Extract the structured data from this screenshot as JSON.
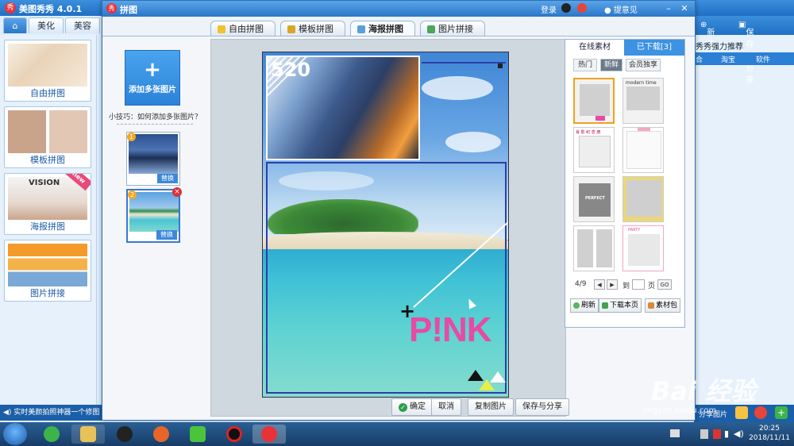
{
  "back_app": {
    "title": "美图秀秀 4.0.1",
    "tabs": [
      "美化",
      "美容"
    ],
    "sidebar": [
      {
        "label": "自由拼图"
      },
      {
        "label": "模板拼图"
      },
      {
        "label": "海报拼图",
        "badge": "new",
        "poster_text": "VISION"
      },
      {
        "label": "图片拼接"
      }
    ],
    "status_text": "实时美颜拍照神器一个修图",
    "right_toolbar": {
      "new_label": "新建",
      "save_label": "保存与分享"
    },
    "recommend_title": "秀秀强力推荐",
    "right_tabs": [
      "合",
      "淘宝",
      "软件"
    ],
    "share_label": "分享图片"
  },
  "dialog": {
    "title": "拼图",
    "login_label": "登录",
    "feedback_label": "提意见",
    "tabs": [
      {
        "label": "自由拼图",
        "active": false,
        "icon_color": "#f2c12e"
      },
      {
        "label": "模板拼图",
        "active": false,
        "icon_color": "#d9a62a"
      },
      {
        "label": "海报拼图",
        "active": true,
        "icon_color": "#5aa0d8"
      },
      {
        "label": "图片拼接",
        "active": false,
        "icon_color": "#4da65a"
      }
    ],
    "add_images_label": "添加多张图片",
    "tip_text": "小技巧：如何添加多张图片？",
    "slots": [
      {
        "num": "1",
        "replace_label": "替换"
      },
      {
        "num": "2",
        "replace_label": "替换",
        "delete_label": "×"
      }
    ],
    "poster": {
      "badge_text": "520",
      "pink_text": "P!NK"
    },
    "actions": {
      "confirm_label": "确定",
      "cancel_label": "取消",
      "copy_label": "复制图片",
      "save_share_label": "保存与分享"
    },
    "right_panel": {
      "tabs": [
        {
          "label": "在线素材",
          "active": true
        },
        {
          "label": "已下载[3]",
          "active": false
        }
      ],
      "subtabs": [
        {
          "label": "热门",
          "active": false
        },
        {
          "label": "新鲜",
          "active": true
        },
        {
          "label": "会员独享",
          "active": false
        }
      ],
      "template_texts": [
        "modern time",
        "PERFECT",
        "PARTY",
        "肖 影 纪 念 册"
      ],
      "pager": {
        "page_text": "4/9",
        "goto_label": "到",
        "page_unit": "页",
        "go_label": "GO"
      },
      "buttons": {
        "refresh_label": "刷新",
        "download_label": "下载本页",
        "package_label": "素材包"
      }
    }
  },
  "taskbar": {
    "time": "20:25",
    "date": "2018/11/11"
  },
  "watermark": {
    "big": "Bai 经验",
    "small": "jingyan.baidu.com"
  },
  "colors": {
    "accent": "#2b83d8",
    "pink": "#e84aa4",
    "poster_border": "#2c3fa8",
    "selected_template": "#f0a020"
  }
}
